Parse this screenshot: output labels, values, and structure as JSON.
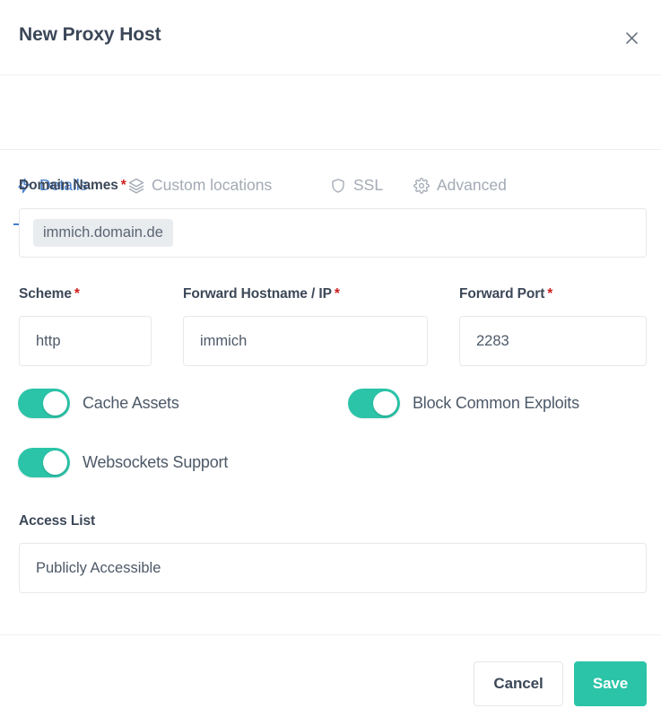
{
  "header": {
    "title": "New Proxy Host",
    "close_icon": "close-icon"
  },
  "tabs": [
    {
      "id": "details",
      "label": "Details",
      "icon": "lightning-bolt-icon",
      "active": true
    },
    {
      "id": "custom",
      "label": "Custom locations",
      "icon": "layers-icon",
      "active": false
    },
    {
      "id": "ssl",
      "label": "SSL",
      "icon": "shield-icon",
      "active": false
    },
    {
      "id": "advanced",
      "label": "Advanced",
      "icon": "gear-icon",
      "active": false
    }
  ],
  "form": {
    "domain_names": {
      "label": "Domain Names",
      "required": "*",
      "chips": [
        "immich.domain.de"
      ]
    },
    "scheme": {
      "label": "Scheme",
      "required": "*",
      "value": "http"
    },
    "forward_hostname": {
      "label": "Forward Hostname / IP",
      "required": "*",
      "value": "immich"
    },
    "forward_port": {
      "label": "Forward Port",
      "required": "*",
      "value": "2283"
    },
    "access_list": {
      "label": "Access List",
      "value": "Publicly Accessible"
    }
  },
  "toggles": [
    {
      "id": "cache_assets",
      "label": "Cache Assets",
      "on": true
    },
    {
      "id": "block_common_exploits",
      "label": "Block Common Exploits",
      "on": true
    },
    {
      "id": "websockets_support",
      "label": "Websockets Support",
      "on": true
    }
  ],
  "footer": {
    "cancel_label": "Cancel",
    "save_label": "Save"
  },
  "colors": {
    "accent_teal": "#2bc4a8",
    "accent_blue": "#467fcf",
    "required_red": "#cd201f",
    "text_dark": "#3c4858",
    "text_muted": "#a3aab4",
    "border": "#e6e8eb"
  }
}
